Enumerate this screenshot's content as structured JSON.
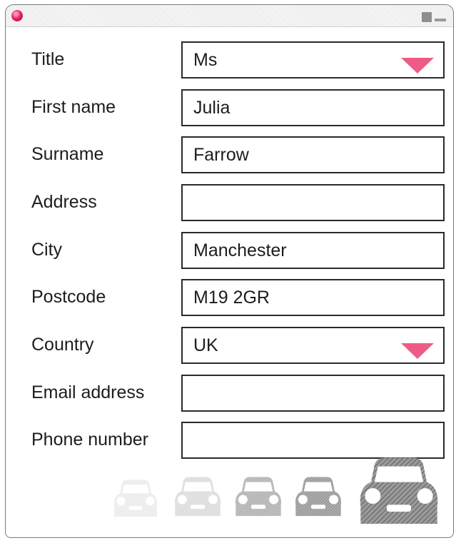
{
  "form": {
    "rows": [
      {
        "label": "Title",
        "value": "Ms",
        "type": "select"
      },
      {
        "label": "First name",
        "value": "Julia",
        "type": "text"
      },
      {
        "label": "Surname",
        "value": "Farrow",
        "type": "text"
      },
      {
        "label": "Address",
        "value": "",
        "type": "text"
      },
      {
        "label": "City",
        "value": "Manchester",
        "type": "text"
      },
      {
        "label": "Postcode",
        "value": "M19 2GR",
        "type": "text"
      },
      {
        "label": "Country",
        "value": "UK",
        "type": "select"
      },
      {
        "label": "Email address",
        "value": "",
        "type": "text"
      },
      {
        "label": "Phone number",
        "value": "",
        "type": "text"
      }
    ]
  },
  "progress": {
    "total_steps": 5,
    "current_step": 5
  },
  "colors": {
    "accent": "#ee5b86",
    "close_button": "#e8245f",
    "border": "#2a2a2a"
  },
  "icons": {
    "close": "close-dot-icon",
    "dropdown": "dropdown-triangle-icon",
    "progress": "car-icon"
  }
}
